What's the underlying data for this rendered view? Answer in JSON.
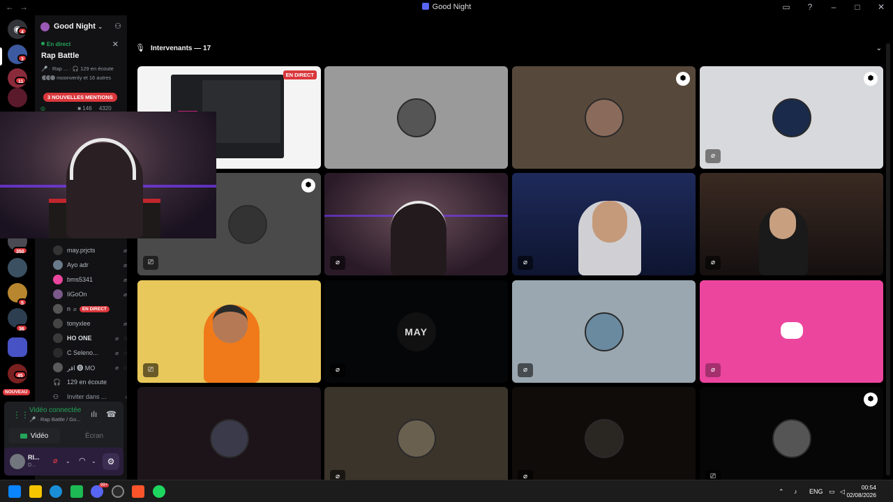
{
  "window": {
    "title": "Good Night"
  },
  "server": {
    "name": "Good Night"
  },
  "live_card": {
    "live_label": "En direct",
    "channel": "Rap Battle",
    "meta_path": "🎤 · Rap ...",
    "listeners": "129 en écoute",
    "participants": "moonvenly et 16 autres",
    "mentions": "3 NOUVELLES MENTIONS",
    "stat1": "146",
    "stat2": "4320"
  },
  "rail_badges": [
    "4",
    "3",
    "11",
    "350",
    "5",
    "36",
    "45"
  ],
  "rail_new": "NOUVEAU",
  "members": [
    {
      "name": "may.prjcts",
      "live": ""
    },
    {
      "name": "Ayo adr",
      "live": ""
    },
    {
      "name": "bms5341",
      "live": ""
    },
    {
      "name": "IiGoOn",
      "live": ""
    },
    {
      "name": "n",
      "live": "EN DIRECT"
    },
    {
      "name": "tonyxlee",
      "live": ""
    },
    {
      "name": "HO ONE",
      "live": ""
    },
    {
      "name": "C Seleno...",
      "live": ""
    },
    {
      "name": "اقر ⓿ MO",
      "live": ""
    }
  ],
  "listeners_row": "129 en écoute",
  "invite_row": "Inviter dans ...",
  "voice": {
    "status": "Vidéo connectée",
    "channel": "🎤 · Rap Battle / Go...",
    "video_btn": "Vidéo",
    "screen_btn": "Écran"
  },
  "user": {
    "name": "RI...",
    "status": "D..."
  },
  "stage": {
    "heading": "Intervenants — 17",
    "live_badge": "EN DIRECT",
    "may_tag": "MAY"
  },
  "taskbar": {
    "lang": "ENG",
    "time": "00:54",
    "date": "02/08/2026",
    "discord_badge": "99+"
  },
  "colors": {
    "accent": "#5865f2",
    "live_red": "#da373c",
    "online_green": "#23a55a",
    "discord_pink": "#eb459e"
  }
}
